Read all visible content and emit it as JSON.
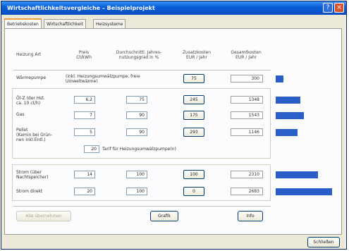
{
  "window": {
    "title": "Wirtschaftlichkeitsvergleiche – Beispielprojekt",
    "help": "?",
    "close": "×"
  },
  "tabs": [
    {
      "label": "Betriebskosten",
      "active": true
    },
    {
      "label": "Wirtschaftlichkeit",
      "active": false
    },
    {
      "label": "Heizsysteme",
      "active": false
    }
  ],
  "headers": {
    "heizung_art": "Heizung Art",
    "preis": "Preis\nCt/kWh",
    "wirkungsgrad": "Durchschnittl. Jahres-\nnutzungsgrad in %",
    "zusatzkosten": "Zusatzkosten\nEUR / Jahr",
    "gesamtkosten": "Gesamtkosten\nEUR / Jahr"
  },
  "rows": [
    {
      "label": "Wärmepumpe",
      "note": "(inkl. Heizungsumwälzpumpe, freie Umweltwärme)",
      "preis": "",
      "nutzung": "",
      "zusatz": "75",
      "gesamt": "300",
      "level": 0.12
    },
    {
      "label": "Öl-Z (der Hst.\nca. 10 ct/h)",
      "preis": "6,2",
      "nutzung": "75",
      "zusatz": "245",
      "gesamt": "1348",
      "level": 0.38
    },
    {
      "label": "Gas",
      "preis": "7",
      "nutzung": "90",
      "zusatz": "175",
      "gesamt": "1543",
      "level": 0.44
    },
    {
      "label": "Pellet\n(Kamin bei Grün-\nnen inkl.Entl.)",
      "preis": "5",
      "nutzung": "90",
      "zusatz": "293",
      "gesamt": "1146",
      "level": 0.34
    },
    {
      "label": "Strom (über\nNachtspeicher)",
      "preis": "14",
      "nutzung": "100",
      "zusatz": "100",
      "gesamt": "2310",
      "level": 0.65
    },
    {
      "label": "Strom direkt",
      "preis": "20",
      "nutzung": "100",
      "zusatz": "0",
      "gesamt": "2683",
      "level": 0.87
    }
  ],
  "extra": {
    "value": "20",
    "label": "Tarif für Heizungsumwälzpumpe(n)"
  },
  "buttons": {
    "details": "Alle übernehmen",
    "grafik": "Grafik",
    "info": "Info",
    "close": "Schließen"
  },
  "colors": {
    "bar": "#2a5ec8",
    "titlebar": "#0a5fd8"
  }
}
